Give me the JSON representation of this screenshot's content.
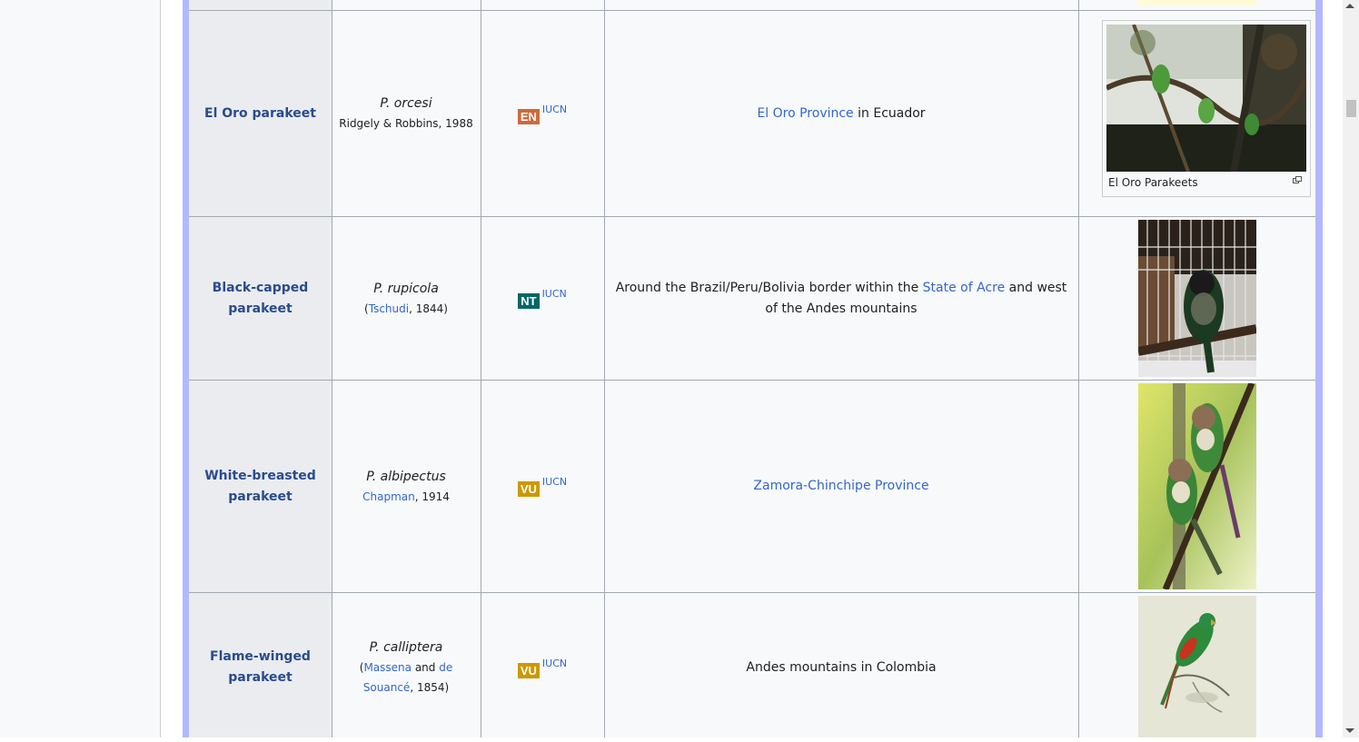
{
  "table": {
    "rows": [
      {
        "common_name": "El Oro parakeet",
        "sci_name": "P. orcesi",
        "authority_plain": "Ridgely & Robbins, 1988",
        "status": {
          "code": "EN",
          "color": "#cd6a3c",
          "source": "IUCN"
        },
        "range_link_1": "El Oro Province",
        "range_text_1": " in Ecuador",
        "image": {
          "caption": "El Oro Parakeets",
          "kind": "forest-photo"
        }
      },
      {
        "common_name": "Black-capped parakeet",
        "sci_name": "P. rupicola",
        "authority_open": "(",
        "authority_link": "Tschudi",
        "authority_tail": ", 1844)",
        "status": {
          "code": "NT",
          "color": "#006666",
          "source": "IUCN"
        },
        "range_text_1": "Around the Brazil/Peru/Bolivia border within the ",
        "range_link_1": "State of Acre",
        "range_text_2": " and west of the Andes mountains",
        "image": {
          "kind": "cage-photo"
        }
      },
      {
        "common_name": "White-breasted parakeet",
        "sci_name": "P. albipectus",
        "authority_link": "Chapman",
        "authority_tail": ", 1914",
        "status": {
          "code": "VU",
          "color": "#cc9900",
          "source": "IUCN"
        },
        "range_link_1": "Zamora-Chinchipe Province",
        "image": {
          "kind": "branch-photo"
        }
      },
      {
        "common_name": "Flame-winged parakeet",
        "sci_name": "P. calliptera",
        "authority_open": "(",
        "authority_link": "Massena",
        "authority_mid": " and ",
        "authority_link_2": "de Souancé",
        "authority_tail": ", 1854)",
        "status": {
          "code": "VU",
          "color": "#cc9900",
          "source": "IUCN"
        },
        "range_text_1": "Andes mountains in Colombia",
        "image": {
          "kind": "illustration"
        }
      }
    ]
  }
}
